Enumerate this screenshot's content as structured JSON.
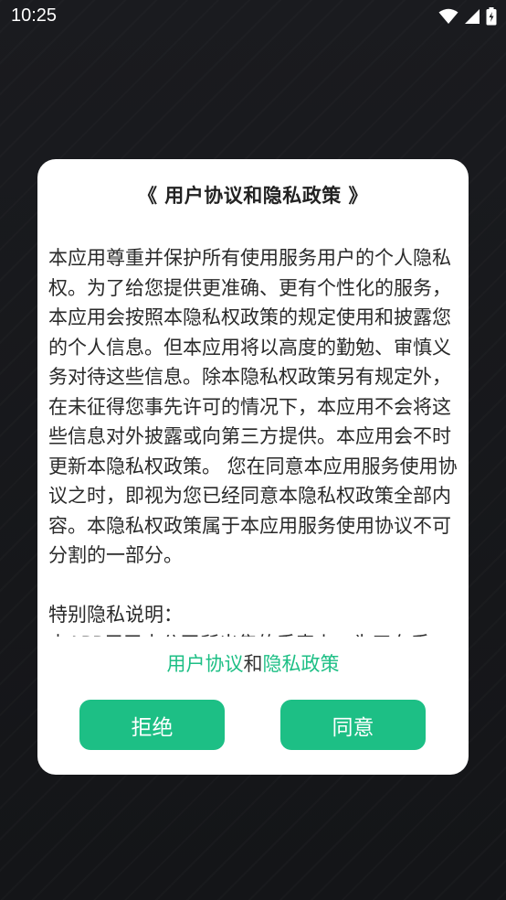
{
  "status_bar": {
    "time": "10:25",
    "icons": [
      "wifi-icon",
      "signal-icon",
      "battery-icon"
    ]
  },
  "dialog": {
    "title": "《 用户协议和隐私政策 》",
    "body_paragraph_1": "本应用尊重并保护所有使用服务用户的个人隐私权。为了给您提供更准确、更有个性化的服务，本应用会按照本隐私权政策的规定使用和披露您的个人信息。但本应用将以高度的勤勉、审慎义务对待这些信息。除本隐私权政策另有规定外，在未征得您事先许可的情况下，本应用不会将这些信息对外披露或向第三方提供。本应用会不时更新本隐私权政策。 您在同意本应用服务使用协议之时，即视为您已经同意本隐私权政策全部内容。本隐私权政策属于本应用服务使用协议不可分割的一部分。",
    "body_heading_2": "特别隐私说明：",
    "body_paragraph_2": "本APP用于本公司所出售的手表上，为了在手",
    "links": {
      "user_agreement": "用户协议",
      "conjunction": "和",
      "privacy_policy": "隐私政策"
    },
    "buttons": {
      "refuse": "拒绝",
      "agree": "同意"
    }
  },
  "colors": {
    "accent": "#1dbf85",
    "background": "#16171a",
    "dialog": "#ffffff",
    "text": "#2a2a2a"
  }
}
